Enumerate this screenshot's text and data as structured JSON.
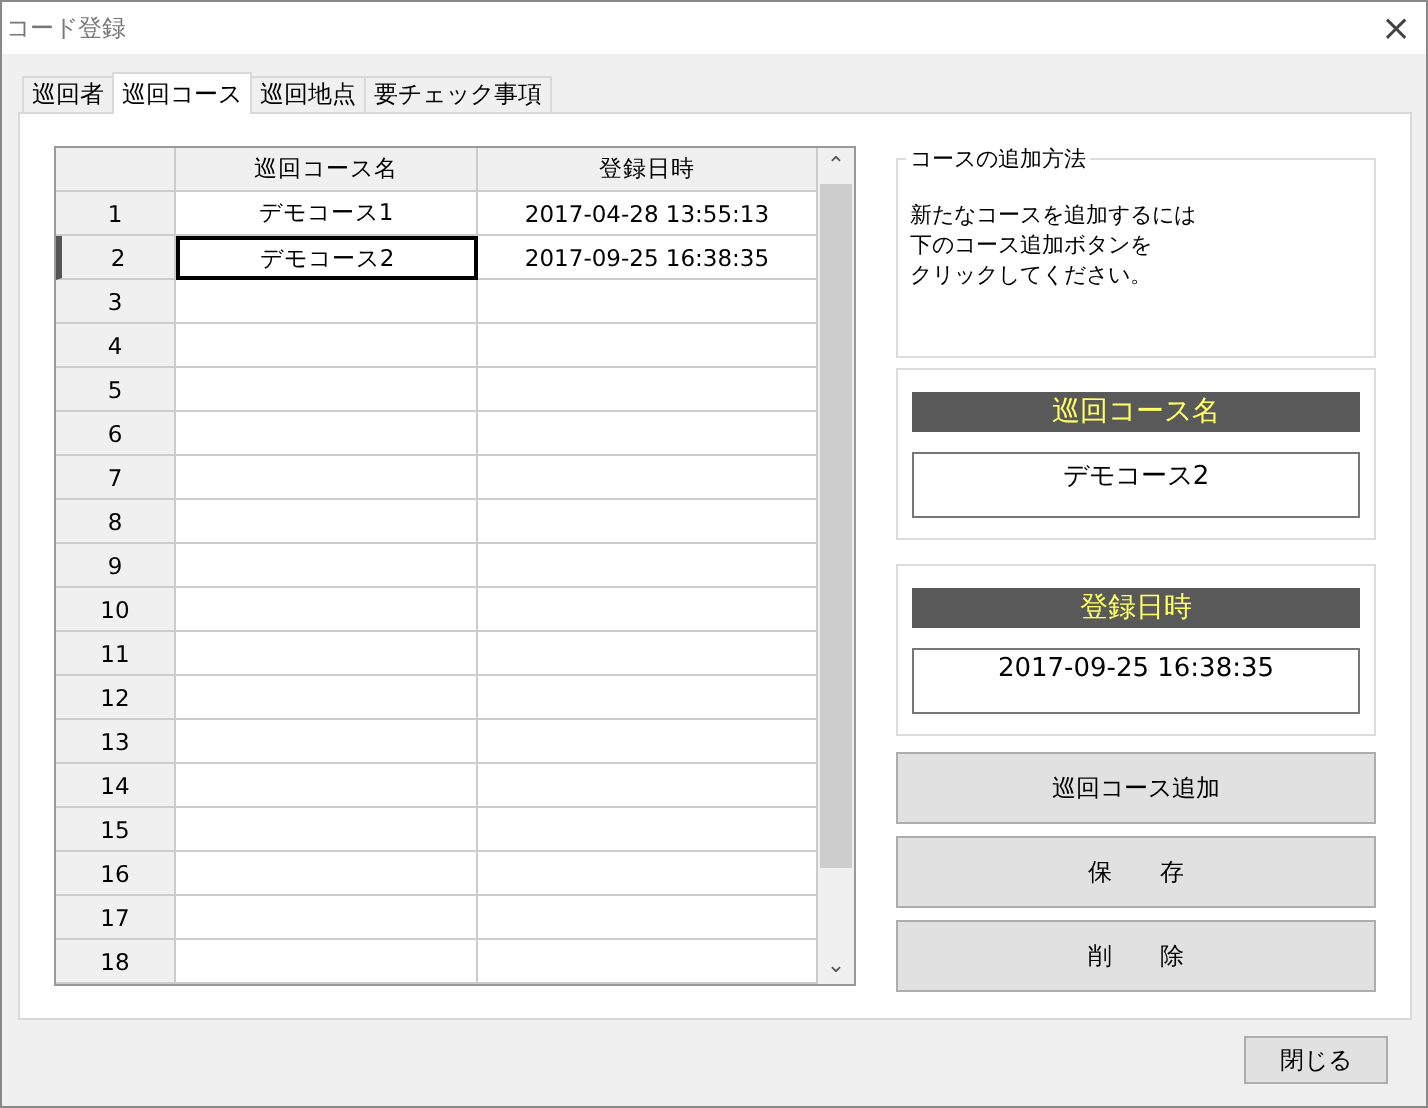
{
  "window": {
    "title": "コード登録",
    "close": "×"
  },
  "tabs": [
    {
      "label": "巡回者",
      "selected": false
    },
    {
      "label": "巡回コース",
      "selected": true
    },
    {
      "label": "巡回地点",
      "selected": false
    },
    {
      "label": "要チェック事項",
      "selected": false
    }
  ],
  "table": {
    "columns": [
      "巡回コース名",
      "登録日時"
    ],
    "scroll_up": "⌃",
    "scroll_down": "⌄",
    "rows": [
      {
        "number": "1",
        "name": "デモコース1",
        "date": "2017-04-28 13:55:13",
        "selected": false
      },
      {
        "number": "2",
        "name": "デモコース2",
        "date": "2017-09-25 16:38:35",
        "selected": true
      },
      {
        "number": "3",
        "selected": false
      },
      {
        "number": "4",
        "selected": false
      },
      {
        "number": "5",
        "selected": false
      },
      {
        "number": "6",
        "selected": false
      },
      {
        "number": "7",
        "selected": false
      },
      {
        "number": "8",
        "selected": false
      },
      {
        "number": "9",
        "selected": false
      },
      {
        "number": "10",
        "selected": false
      },
      {
        "number": "11",
        "selected": false
      },
      {
        "number": "12",
        "selected": false
      },
      {
        "number": "13",
        "selected": false
      },
      {
        "number": "14",
        "selected": false
      },
      {
        "number": "15",
        "selected": false
      },
      {
        "number": "16",
        "selected": false
      },
      {
        "number": "17",
        "selected": false
      },
      {
        "number": "18",
        "selected": false
      }
    ]
  },
  "help": {
    "title": "コースの追加方法",
    "lines": [
      "新たなコースを追加するには",
      "下のコース追加ボタンを",
      "クリックしてください。"
    ]
  },
  "fields": [
    {
      "label": "巡回コース名",
      "value": "デモコース2"
    },
    {
      "label": "登録日時",
      "value": "2017-09-25 16:38:35"
    }
  ],
  "buttons": [
    "巡回コース追加",
    "保　　存",
    "削　　除"
  ],
  "close_button": "閉じる"
}
